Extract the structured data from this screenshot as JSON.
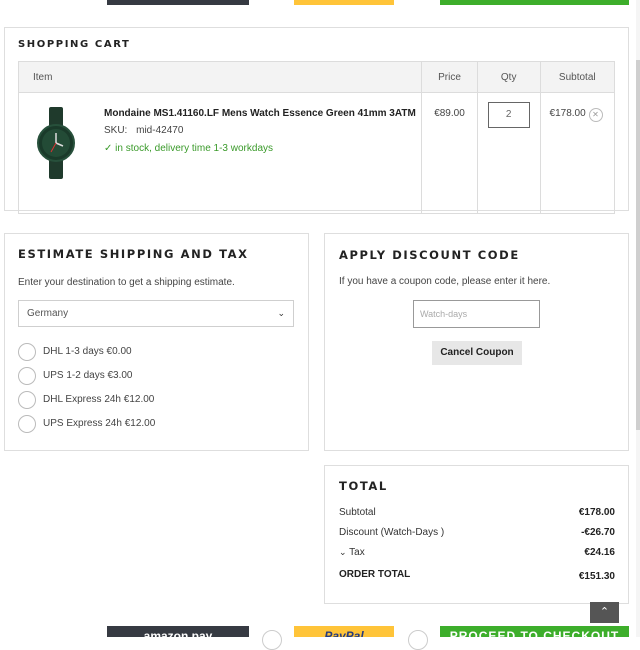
{
  "cart": {
    "heading": "SHOPPING CART",
    "columns": {
      "item": "Item",
      "price": "Price",
      "qty": "Qty",
      "subtotal": "Subtotal"
    },
    "items": [
      {
        "name": "Mondaine MS1.41160.LF Mens Watch Essence Green 41mm 3ATM",
        "sku_label": "SKU:",
        "sku": "mid-42470",
        "stock": "in stock, delivery time 1-3 workdays",
        "price": "€89.00",
        "qty": "2",
        "subtotal": "€178.00"
      }
    ]
  },
  "shipping": {
    "heading": "ESTIMATE SHIPPING AND TAX",
    "intro": "Enter your destination to get a shipping estimate.",
    "country": "Germany",
    "options": [
      "DHL 1-3 days €0.00",
      "UPS 1-2 days €3.00",
      "DHL Express 24h €12.00",
      "UPS Express 24h €12.00"
    ]
  },
  "discount": {
    "heading": "APPLY DISCOUNT CODE",
    "intro": "If you have a coupon code, please enter it here.",
    "placeholder": "Watch-days",
    "cancel_label": "Cancel Coupon"
  },
  "totals": {
    "heading": "TOTAL",
    "subtotal_label": "Subtotal",
    "subtotal": "€178.00",
    "discount_label": "Discount (Watch-Days )",
    "discount": "-€26.70",
    "tax_label": "Tax",
    "tax": "€24.16",
    "order_total_label": "ORDER TOTAL",
    "order_total": "€151.30"
  },
  "bottom": {
    "amazon": "amazon pay",
    "paypal": "PayPal",
    "checkout": "PROCEED TO CHECKOUT"
  },
  "colors": {
    "green": "#3dae2b",
    "dark": "#363a42",
    "yellow": "#ffc439",
    "paypal_blue": "#253b80"
  }
}
